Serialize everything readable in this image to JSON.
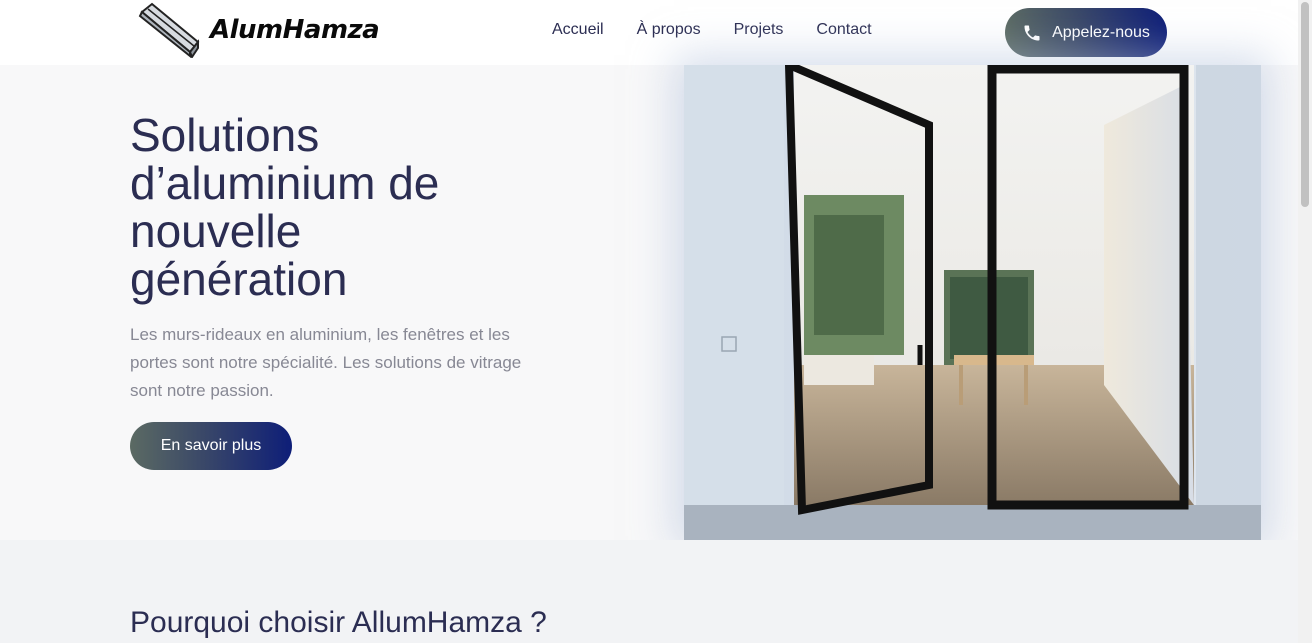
{
  "brand": {
    "name": "AlumHamza"
  },
  "nav": {
    "items": [
      {
        "label": "Accueil"
      },
      {
        "label": "À propos"
      },
      {
        "label": "Projets"
      },
      {
        "label": "Contact"
      }
    ],
    "call_label": "Appelez-nous"
  },
  "hero": {
    "title": "Solutions d’aluminium de nouvelle génération",
    "description": "Les murs-rideaux en aluminium, les fenêtres et les portes sont notre spécialité. Les solutions de vitrage sont notre passion.",
    "cta_label": "En savoir plus",
    "image_icon": "glass-pivot-door-photo"
  },
  "why": {
    "title": "Pourquoi choisir AllumHamza ?"
  },
  "colors": {
    "primary_text": "#2b2d52",
    "muted_text": "#878894",
    "gradient_start": "#5b6a63",
    "gradient_end": "#0e1e78"
  }
}
